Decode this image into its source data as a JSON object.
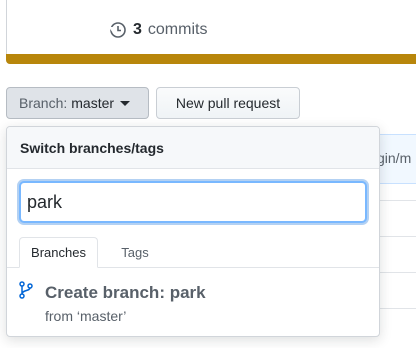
{
  "summary": {
    "commit_count": "3",
    "commit_label": "commits"
  },
  "colors": {
    "language_bar": "#b8860b",
    "focus_ring": "#79b8ff"
  },
  "toolbar": {
    "branch_label": "Branch:",
    "branch_value": "master",
    "new_pr_label": "New pull request"
  },
  "background": {
    "path_fragment": "gin/m"
  },
  "dropdown": {
    "title": "Switch branches/tags",
    "filter_value": "park",
    "tabs": [
      {
        "label": "Branches",
        "selected": true
      },
      {
        "label": "Tags",
        "selected": false
      }
    ],
    "create_branch": {
      "title": "Create branch: park",
      "subtitle": "from ‘master’",
      "icon": "git-branch-icon"
    }
  }
}
